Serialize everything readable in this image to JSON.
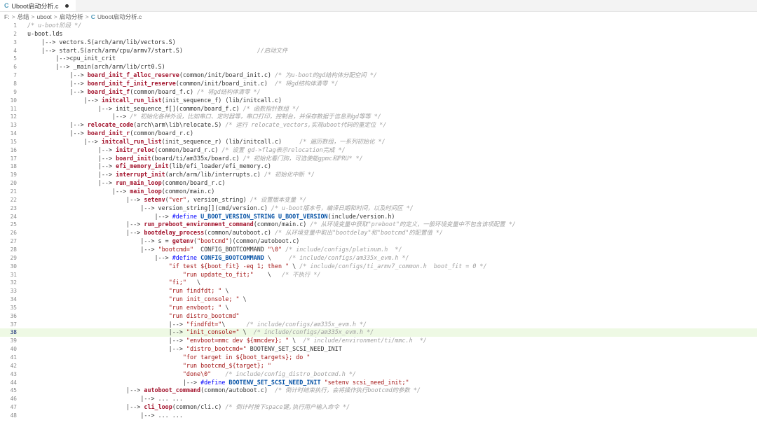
{
  "tab": {
    "icon": "c-file-icon",
    "icon_glyph": "C",
    "label": "Uboot启动分析.c"
  },
  "breadcrumb": {
    "parts": [
      "F:",
      "总结",
      "uboot",
      "启动分析"
    ],
    "file_icon_glyph": "C",
    "file": "Uboot启动分析.c"
  },
  "editor": {
    "active_line": 38,
    "lines": [
      {
        "n": "1",
        "t": [
          [
            "cm",
            "/* u-boot阶段 */"
          ]
        ]
      },
      {
        "n": "2",
        "t": [
          [
            "p",
            "u-boot.lds"
          ]
        ]
      },
      {
        "n": "3",
        "t": [
          [
            "p",
            "    |--> vectors.S(arch/arm/lib/vectors.S)"
          ]
        ]
      },
      {
        "n": "4",
        "t": [
          [
            "p",
            "    |--> start.S(arch/arm/cpu/armv7/start.S)"
          ],
          [
            "p",
            "                     "
          ],
          [
            "cm",
            "//启动文件"
          ]
        ]
      },
      {
        "n": "5",
        "t": [
          [
            "p",
            "        |-->cpu_init_crit"
          ]
        ]
      },
      {
        "n": "6",
        "t": [
          [
            "p",
            "        |--> _main(arch/arm/lib/crt0.S)"
          ]
        ]
      },
      {
        "n": "7",
        "t": [
          [
            "p",
            "            |--> "
          ],
          [
            "fn",
            "board_init_f_alloc_reserve"
          ],
          [
            "p",
            "(common/init/board_init.c) "
          ],
          [
            "cm",
            "/* 为u-boot的gd结构体分配空间 */"
          ]
        ]
      },
      {
        "n": "8",
        "t": [
          [
            "p",
            "            |--> "
          ],
          [
            "fn",
            "board_init_f_init_reserve"
          ],
          [
            "p",
            "(common/init/board_init.c)  "
          ],
          [
            "cm",
            "/* 将gd结构体清零 */"
          ]
        ]
      },
      {
        "n": "9",
        "t": [
          [
            "p",
            "            |--> "
          ],
          [
            "fn",
            "board_init_f"
          ],
          [
            "p",
            "(common/board_f.c) "
          ],
          [
            "cm",
            "/* 将gd结构体清零 */"
          ]
        ]
      },
      {
        "n": "10",
        "t": [
          [
            "p",
            "                |--> "
          ],
          [
            "fn",
            "initcall_run_list"
          ],
          [
            "p",
            "(init_sequence_f) (lib/initcall.c)"
          ]
        ]
      },
      {
        "n": "11",
        "t": [
          [
            "p",
            "                    |--> init_sequence_f[](common/board_f.c) "
          ],
          [
            "cm",
            "/* 函数指针数组 */"
          ]
        ]
      },
      {
        "n": "12",
        "t": [
          [
            "p",
            "                        |--> "
          ],
          [
            "cm",
            "/* 初始化各种外设，比如串口、定时器等，串口打印，控制台，并保存数据于信息到gd等等 */"
          ]
        ]
      },
      {
        "n": "13",
        "t": [
          [
            "p",
            "            |--> "
          ],
          [
            "fn",
            "relocate_code"
          ],
          [
            "p",
            "(arch\\arm\\lib\\relocate.S) "
          ],
          [
            "cm",
            "/* 运行 relocate_vectors,实现uboot代码的重定位 */"
          ]
        ]
      },
      {
        "n": "14",
        "t": [
          [
            "p",
            "            |--> "
          ],
          [
            "fn",
            "board_init_r"
          ],
          [
            "p",
            "(common/board_r.c)"
          ]
        ]
      },
      {
        "n": "15",
        "t": [
          [
            "p",
            "                |--> "
          ],
          [
            "fn",
            "initcall_run_list"
          ],
          [
            "p",
            "(init_sequence_r) (lib/initcall.c)     "
          ],
          [
            "cm",
            "/* 遍历数组，一系列初始化 */"
          ]
        ]
      },
      {
        "n": "16",
        "t": [
          [
            "p",
            "                    |--> "
          ],
          [
            "fn",
            "initr_reloc"
          ],
          [
            "p",
            "(common/board_r.c) "
          ],
          [
            "cm",
            "/* 设置 gd->flag表示relocation完成 */"
          ]
        ]
      },
      {
        "n": "17",
        "t": [
          [
            "p",
            "                    |--> "
          ],
          [
            "fn",
            "board_init"
          ],
          [
            "p",
            "(board/ti/am335x/board.c) "
          ],
          [
            "cm",
            "/* 初始化看门狗，可选使能gpmc和PRU* */"
          ]
        ]
      },
      {
        "n": "18",
        "t": [
          [
            "p",
            "                    |--> "
          ],
          [
            "fn",
            "efi_memory_init"
          ],
          [
            "p",
            "(lib/efi_loader/efi_memory.c)"
          ]
        ]
      },
      {
        "n": "19",
        "t": [
          [
            "p",
            "                    |--> "
          ],
          [
            "fn",
            "interrupt_init"
          ],
          [
            "p",
            "(arch/arm/lib/interrupts.c) "
          ],
          [
            "cm",
            "/* 初始化中断 */"
          ]
        ]
      },
      {
        "n": "20",
        "t": [
          [
            "p",
            "                    |--> "
          ],
          [
            "fn",
            "run_main_loop"
          ],
          [
            "p",
            "(common/board_r.c)"
          ]
        ]
      },
      {
        "n": "21",
        "t": [
          [
            "p",
            "                        |--> "
          ],
          [
            "fn",
            "main_loop"
          ],
          [
            "p",
            "(common/main.c)"
          ]
        ]
      },
      {
        "n": "22",
        "t": [
          [
            "p",
            "                            |--> "
          ],
          [
            "fn",
            "setenv"
          ],
          [
            "p",
            "("
          ],
          [
            "str",
            "\"ver\""
          ],
          [
            "p",
            ", version_string) "
          ],
          [
            "cm",
            "/* 设置版本变量 */"
          ]
        ]
      },
      {
        "n": "23",
        "t": [
          [
            "p",
            "                                |--> version_string[](cmd/version.c) "
          ],
          [
            "cm",
            "/* u-boot版本号，编译日期和时间，以及时间区 */"
          ]
        ]
      },
      {
        "n": "24",
        "t": [
          [
            "p",
            "                                    |--> "
          ],
          [
            "kw",
            "#define"
          ],
          [
            "p",
            " "
          ],
          [
            "mac",
            "U_BOOT_VERSION_STRING U_BOOT_VERSION"
          ],
          [
            "p",
            "(include/version.h)"
          ]
        ]
      },
      {
        "n": "25",
        "t": [
          [
            "p",
            "                            |--> "
          ],
          [
            "fn",
            "run_preboot_environment_command"
          ],
          [
            "p",
            "(common/main.c) "
          ],
          [
            "cm",
            "/* 从环境变量中获取\"preboot\"的定义，一般环境变量中不包含该项配置 */"
          ]
        ]
      },
      {
        "n": "26",
        "t": [
          [
            "p",
            "                            |--> "
          ],
          [
            "fn",
            "bootdelay_process"
          ],
          [
            "p",
            "(common/autoboot.c) "
          ],
          [
            "cm",
            "/* 从环境变量中取出\"bootdelay\"和\"bootcmd\"的配置值 */"
          ]
        ]
      },
      {
        "n": "27",
        "t": [
          [
            "p",
            "                                |--> s = "
          ],
          [
            "fn",
            "getenv"
          ],
          [
            "p",
            "("
          ],
          [
            "str",
            "\"bootcmd\""
          ],
          [
            "p",
            ")(common/autoboot.c)"
          ]
        ]
      },
      {
        "n": "28",
        "t": [
          [
            "p",
            "                                |--> "
          ],
          [
            "str",
            "\"bootcmd=\""
          ],
          [
            "p",
            "  CONFIG_BOOTCOMMAND "
          ],
          [
            "str",
            "\"\\0\""
          ],
          [
            "p",
            " "
          ],
          [
            "cm",
            "/* include/configs/platinum.h  */"
          ]
        ]
      },
      {
        "n": "29",
        "t": [
          [
            "p",
            "                                    |--> "
          ],
          [
            "kw",
            "#define"
          ],
          [
            "p",
            " "
          ],
          [
            "mac",
            "CONFIG_BOOTCOMMAND"
          ],
          [
            "p",
            " \\     "
          ],
          [
            "cm",
            "/* include/configs/am335x_evm.h */"
          ]
        ]
      },
      {
        "n": "30",
        "t": [
          [
            "p",
            "                                        "
          ],
          [
            "str",
            "\"if test ${boot_fit} -eq 1; then \""
          ],
          [
            "p",
            " \\ "
          ],
          [
            "cm",
            "/* include/configs/ti_armv7_common.h  boot_fit = 0 */"
          ]
        ]
      },
      {
        "n": "31",
        "t": [
          [
            "p",
            "                                            "
          ],
          [
            "str",
            "\"run update_to_fit;\""
          ],
          [
            "p",
            "    \\   "
          ],
          [
            "cm",
            "/* 不执行 */"
          ]
        ]
      },
      {
        "n": "32",
        "t": [
          [
            "p",
            "                                        "
          ],
          [
            "str",
            "\"fi;\""
          ],
          [
            "p",
            "   \\"
          ]
        ]
      },
      {
        "n": "33",
        "t": [
          [
            "p",
            "                                        "
          ],
          [
            "str",
            "\"run findfdt; \""
          ],
          [
            "p",
            " \\"
          ]
        ]
      },
      {
        "n": "34",
        "t": [
          [
            "p",
            "                                        "
          ],
          [
            "str",
            "\"run init_console; \""
          ],
          [
            "p",
            " \\"
          ]
        ]
      },
      {
        "n": "35",
        "t": [
          [
            "p",
            "                                        "
          ],
          [
            "str",
            "\"run envboot; \""
          ],
          [
            "p",
            " \\"
          ]
        ]
      },
      {
        "n": "36",
        "t": [
          [
            "p",
            "                                        "
          ],
          [
            "str",
            "\"run distro_bootcmd\""
          ]
        ]
      },
      {
        "n": "37",
        "t": [
          [
            "p",
            "                                        |--> "
          ],
          [
            "str",
            "\"findfdt=\""
          ],
          [
            "p",
            "\\      "
          ],
          [
            "cm",
            "/* include/configs/am335x_evm.h */"
          ]
        ]
      },
      {
        "n": "38",
        "t": [
          [
            "p",
            "                                        |--> "
          ],
          [
            "str",
            "\"init_console=\""
          ],
          [
            "p",
            " \\  "
          ],
          [
            "cm",
            "/* include/configs/am335x_evm.h */"
          ]
        ]
      },
      {
        "n": "39",
        "t": [
          [
            "p",
            "                                        |--> "
          ],
          [
            "str",
            "\"envboot=mmc dev ${mmcdev}; \""
          ],
          [
            "p",
            " \\  "
          ],
          [
            "cm",
            "/* include/environment/ti/mmc.h  */"
          ]
        ]
      },
      {
        "n": "40",
        "t": [
          [
            "p",
            "                                        |--> "
          ],
          [
            "str",
            "\"distro_bootcmd=\""
          ],
          [
            "p",
            " BOOTENV_SET_SCSI_NEED_INIT"
          ]
        ]
      },
      {
        "n": "41",
        "t": [
          [
            "p",
            "                                            "
          ],
          [
            "str",
            "\"for target in ${boot_targets}; do \""
          ]
        ]
      },
      {
        "n": "42",
        "t": [
          [
            "p",
            "                                            "
          ],
          [
            "str",
            "\"run bootcmd_${target}; \""
          ]
        ]
      },
      {
        "n": "43",
        "t": [
          [
            "p",
            "                                            "
          ],
          [
            "str",
            "\"done\\0\""
          ],
          [
            "p",
            "    "
          ],
          [
            "cm",
            "/* include/config_distro_bootcmd.h */"
          ]
        ]
      },
      {
        "n": "44",
        "t": [
          [
            "p",
            "                                            |--> "
          ],
          [
            "kw",
            "#define"
          ],
          [
            "p",
            " "
          ],
          [
            "mac",
            "BOOTENV_SET_SCSI_NEED_INIT"
          ],
          [
            "p",
            " "
          ],
          [
            "str",
            "\"setenv scsi_need_init;\""
          ]
        ]
      },
      {
        "n": "45",
        "t": [
          [
            "p",
            "                            |--> "
          ],
          [
            "fn",
            "autoboot_command"
          ],
          [
            "p",
            "(common/autoboot.c)  "
          ],
          [
            "cm",
            "/* 倒计时结束执行，会将操作执行bootcmd的参数 */"
          ]
        ]
      },
      {
        "n": "46",
        "t": [
          [
            "p",
            "                                |--> ... ..."
          ]
        ]
      },
      {
        "n": "47",
        "t": [
          [
            "p",
            "                            |--> "
          ],
          [
            "fn",
            "cli_loop"
          ],
          [
            "p",
            "(common/cli.c) "
          ],
          [
            "cm",
            "/* 倒计时按下space键,执行用户输入命令 */"
          ]
        ]
      },
      {
        "n": "48",
        "t": [
          [
            "p",
            "                                |--> ... ..."
          ]
        ]
      }
    ]
  },
  "colors": {
    "function": "#a3152e",
    "comment": "#a0a0a0",
    "string": "#a31515",
    "keyword": "#0000ff",
    "active_line_bg": "#eef9e4",
    "highlight_box": "#f0b24a"
  }
}
